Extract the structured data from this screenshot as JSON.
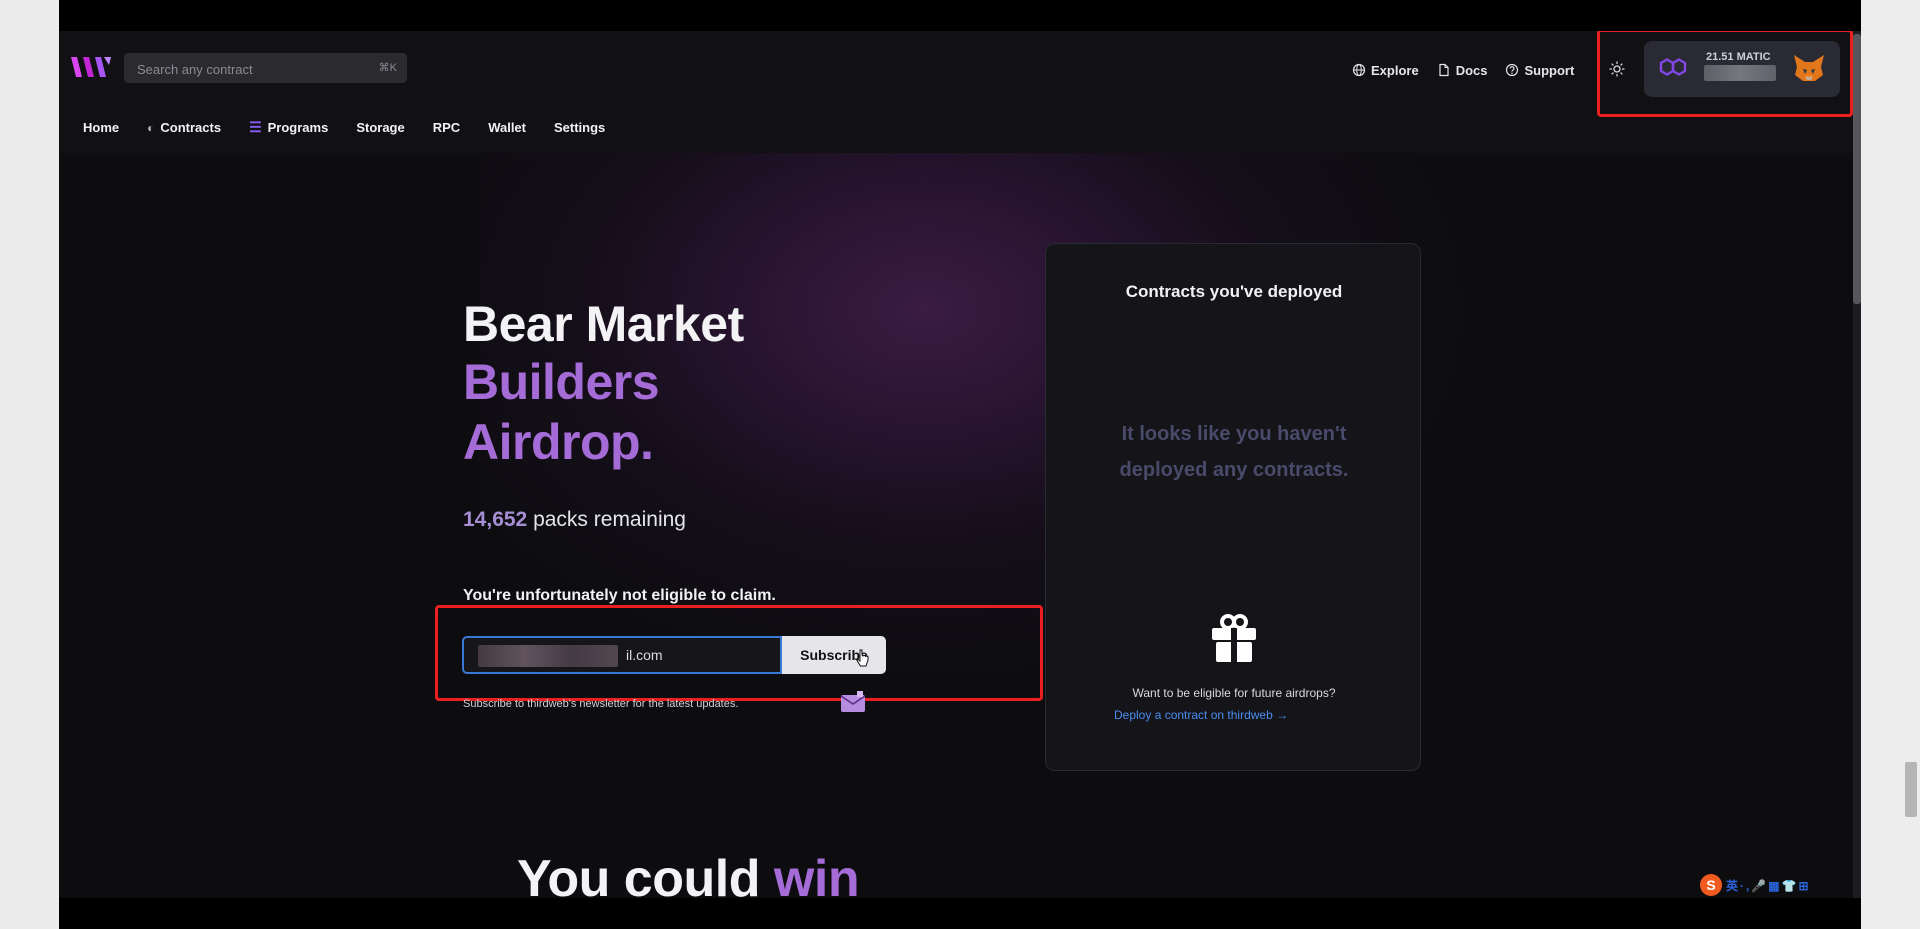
{
  "search": {
    "placeholder": "Search any contract",
    "shortcut": "⌘K"
  },
  "top_links": [
    {
      "label": "Explore",
      "icon": "globe-icon"
    },
    {
      "label": "Docs",
      "icon": "doc-icon"
    },
    {
      "label": "Support",
      "icon": "help-circle-icon"
    }
  ],
  "wallet": {
    "balance_label": "21.51 MATIC",
    "network_icon": "polygon-icon",
    "wallet_icon": "metamask-fox-icon"
  },
  "nav": [
    {
      "label": "Home"
    },
    {
      "label": "Contracts"
    },
    {
      "label": "Programs"
    },
    {
      "label": "Storage"
    },
    {
      "label": "RPC"
    },
    {
      "label": "Wallet"
    },
    {
      "label": "Settings"
    }
  ],
  "hero": {
    "line1": "Bear Market",
    "line2": "Builders",
    "line3": "Airdrop.",
    "packs_count": "14,652",
    "packs_suffix": "packs remaining",
    "eligibility": "You're unfortunately not eligible to claim."
  },
  "subscribe": {
    "email_value": "il.com",
    "button_label": "Subscribe",
    "note": "Subscribe to thirdweb's newsletter for the latest updates."
  },
  "panel": {
    "title": "Contracts you've deployed",
    "empty_line1": "It looks like you haven't",
    "empty_line2": "deployed any contracts.",
    "question": "Want to be eligible for future airdrops?",
    "link": "Deploy a contract on thirdweb →"
  },
  "bottom": {
    "win_text": "You could",
    "win_accent": "win"
  },
  "colors": {
    "accent_purple": "#a56bd6",
    "link_blue": "#4a8df0",
    "highlight_red": "#ea1f1f"
  }
}
